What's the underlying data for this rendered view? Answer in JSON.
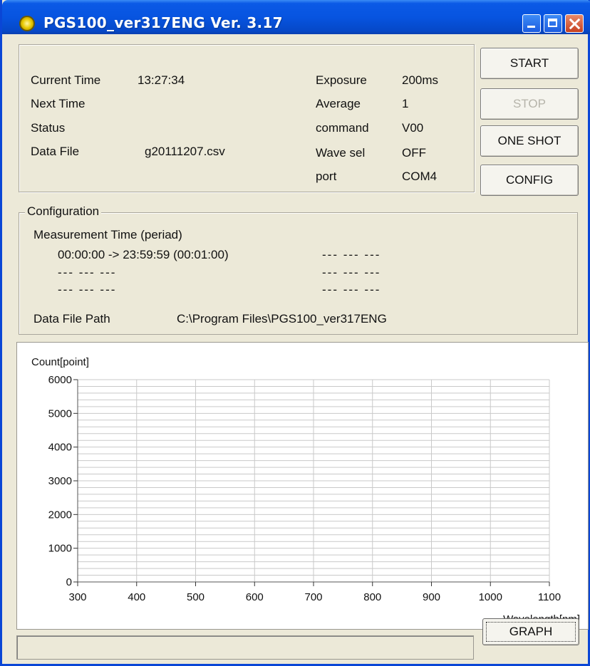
{
  "window": {
    "title": "PGS100_ver317ENG  Ver. 3.17"
  },
  "info": {
    "current_time_label": "Current Time",
    "current_time_value": "13:27:34",
    "next_time_label": "Next Time",
    "status_label": "Status",
    "data_file_label": "Data File",
    "data_file_value": "g20111207.csv",
    "exposure_label": "Exposure",
    "exposure_value": "200ms",
    "average_label": "Average",
    "average_value": "1",
    "command_label": "command",
    "command_value": "V00",
    "wave_sel_label": "Wave sel",
    "wave_sel_value": "OFF",
    "port_label": "port",
    "port_value": "COM4"
  },
  "buttons": {
    "start": "START",
    "stop": "STOP",
    "one_shot": "ONE SHOT",
    "config": "CONFIG",
    "graph": "GRAPH"
  },
  "configuration": {
    "title": "Configuration",
    "measurement_time_label": "Measurement Time (periad)",
    "period_1": "00:00:00 -> 23:59:59  (00:01:00)",
    "empty_slot": "---  ---  ---",
    "data_file_path_label": "Data File Path",
    "data_file_path_value": "C:\\Program Files\\PGS100_ver317ENG"
  },
  "chart_data": {
    "type": "line",
    "title": "",
    "ylabel": "Count[point]",
    "xlabel": "Wavelength[nm]",
    "xlim": [
      300,
      1100
    ],
    "ylim": [
      0,
      6000
    ],
    "xticks": [
      300,
      400,
      500,
      600,
      700,
      800,
      900,
      1000,
      1100
    ],
    "yticks": [
      0,
      1000,
      2000,
      3000,
      4000,
      5000,
      6000
    ],
    "y_minor_step": 200,
    "grid": true,
    "series": []
  },
  "colors": {
    "titlebar": "#0754e0",
    "window_bg": "#ece9d8",
    "disabled_text": "#b6b4aa"
  }
}
